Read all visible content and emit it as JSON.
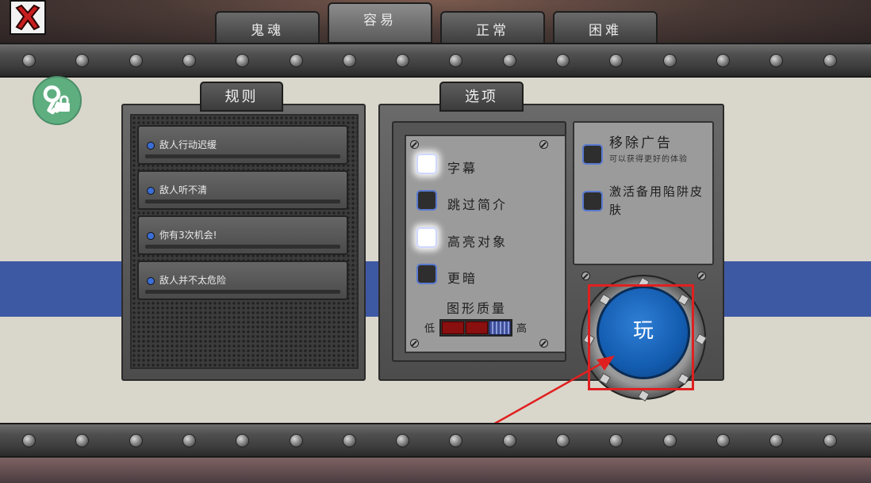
{
  "tabs": [
    {
      "label": "鬼魂",
      "active": false
    },
    {
      "label": "容易",
      "active": true
    },
    {
      "label": "正常",
      "active": false
    },
    {
      "label": "困难",
      "active": false
    }
  ],
  "rules_panel": {
    "title": "规则",
    "items": [
      "敌人行动迟缓",
      "敌人听不清",
      "你有3次机会!",
      "敌人并不太危险"
    ]
  },
  "options_panel": {
    "title": "选项",
    "checkboxes": [
      {
        "label": "字幕",
        "checked": true
      },
      {
        "label": "跳过简介",
        "checked": false
      },
      {
        "label": "高亮对象",
        "checked": true
      },
      {
        "label": "更暗",
        "checked": false
      }
    ],
    "graphics_quality": {
      "label": "图形质量",
      "low_label": "低",
      "high_label": "高",
      "level": 3,
      "levels": 3
    }
  },
  "extras": {
    "remove_ads": {
      "label": "移除广告",
      "subtitle": "可以获得更好的体验",
      "checked": false
    },
    "backup_skin": {
      "label": "激活备用陷阱皮肤",
      "checked": false
    }
  },
  "play_button": {
    "label": "玩"
  },
  "colors": {
    "accent_blue": "#135cb0",
    "stripe_blue": "#3e59a4",
    "highlight_red": "#e02020",
    "lock_green": "#5fae80"
  },
  "icons": {
    "close": "close-x-icon",
    "lock": "key-lock-icon"
  }
}
